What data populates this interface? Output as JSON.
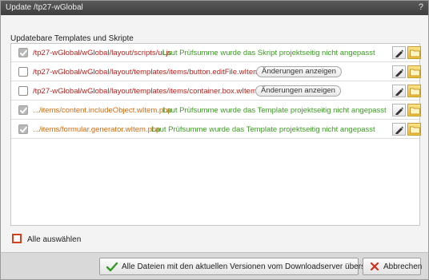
{
  "window": {
    "title": "Update /tp27-wGlobal",
    "help": "?"
  },
  "section_label": "Updatebare Templates und Skripte",
  "rows": [
    {
      "checked": true,
      "path": "/tp27-wGlobal/wGlobal/layout/scripts/ui.js",
      "path_color": "red",
      "message": "Laut Prüfsumme wurde das Skript projektseitig nicht angepasst"
    },
    {
      "checked": false,
      "path": "/tp27-wGlobal/wGlobal/layout/templates/items/button.editFile.wItem.php",
      "path_color": "red",
      "button": "Änderungen anzeigen"
    },
    {
      "checked": false,
      "path": "/tp27-wGlobal/wGlobal/layout/templates/items/container.box.wItem.php",
      "path_color": "red",
      "button": "Änderungen anzeigen"
    },
    {
      "checked": true,
      "path": ".../items/content.includeObject.wItem.php",
      "path_color": "orange",
      "message": "Laut Prüfsumme wurde das Template projektseitig nicht angepasst"
    },
    {
      "checked": true,
      "path": ".../items/formular.generator.wItem.php",
      "path_color": "orange",
      "message": "Laut Prüfsumme wurde das Template projektseitig nicht angepasst"
    }
  ],
  "select_all_label": "Alle auswählen",
  "buttons": {
    "overwrite": "Alle Dateien mit den aktuellen Versionen vom Downloadserver überspielen",
    "cancel": "Abbrechen"
  },
  "colors": {
    "path_red": "#b4231e",
    "path_orange": "#cf6b10",
    "message_green": "#3a9a21",
    "titlebar": "#4a4a4a"
  },
  "icons": {
    "edit": "pencil-icon",
    "folder": "folder-icon",
    "confirm": "checkmark-icon",
    "cancel": "x-icon"
  }
}
